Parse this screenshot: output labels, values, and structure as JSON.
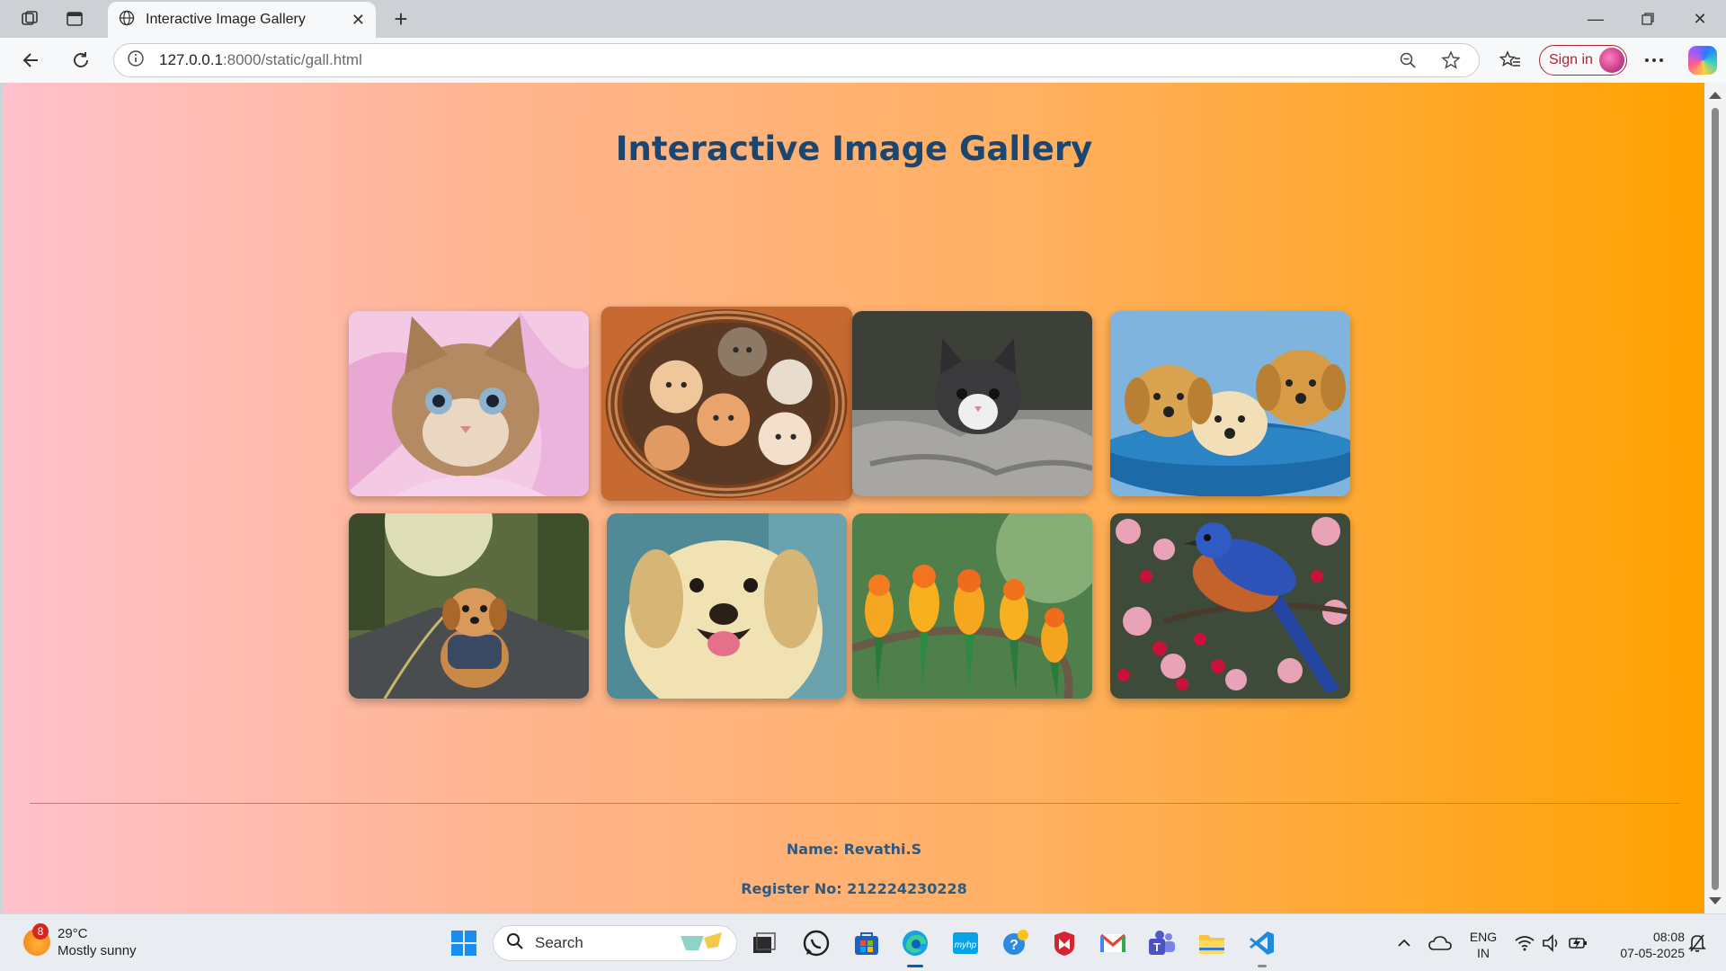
{
  "browser": {
    "tab_title": "Interactive Image Gallery",
    "url_host": "127.0.0.1",
    "url_path": ":8000/static/gall.html",
    "sign_in_label": "Sign in"
  },
  "page": {
    "title": "Interactive Image Gallery",
    "gallery": [
      {
        "subject": "kitten in pink ribbon"
      },
      {
        "subject": "kittens in basket"
      },
      {
        "subject": "kitten on grey blanket"
      },
      {
        "subject": "three puppies on blue cushion"
      },
      {
        "subject": "puppy sitting on road"
      },
      {
        "subject": "smiling labrador puppy"
      },
      {
        "subject": "parakeets on branch"
      },
      {
        "subject": "bluebird among blossoms"
      }
    ],
    "footer": {
      "name": "Name: Revathi.S",
      "register": "Register No: 212224230228"
    }
  },
  "taskbar": {
    "weather_temp": "29°C",
    "weather_desc": "Mostly sunny",
    "weather_badge": "8",
    "search_label": "Search",
    "lang_line1": "ENG",
    "lang_line2": "IN",
    "time": "08:08",
    "date": "07-05-2025"
  }
}
